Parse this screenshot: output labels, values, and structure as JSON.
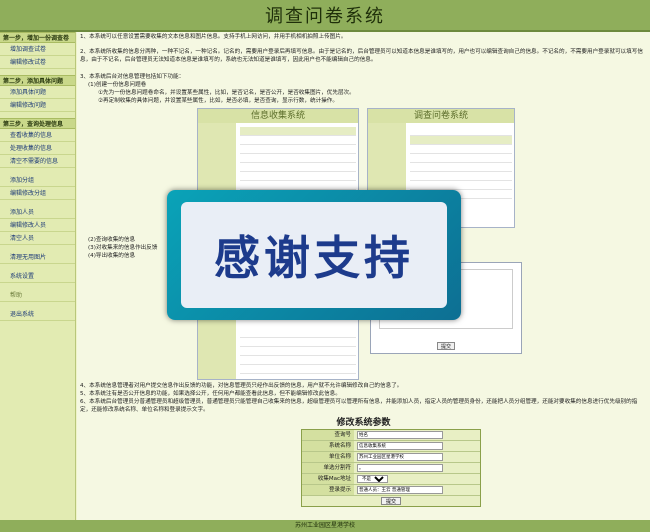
{
  "header": {
    "title": "调查问卷系统"
  },
  "sidebar": {
    "sections": [
      {
        "title": "第一步，增加一份调查卷",
        "items": [
          "增加调查试卷",
          "编辑修改试卷"
        ]
      },
      {
        "title": "第二步，添加具体问题",
        "items": [
          "添加具体问题",
          "编辑修改问题"
        ]
      },
      {
        "title": "第三步，查询处理信息",
        "items": [
          "查看收集的信息",
          "处理收集的信息",
          "清空不需要的信息"
        ]
      }
    ],
    "extra_items": [
      "添加分组",
      "编辑修改分组",
      "添加人员",
      "编辑修改人员",
      "清空人员",
      "清理无用图片",
      "系统设置",
      "帮助",
      "退出系统"
    ]
  },
  "main": {
    "p1": "1、本系统可以任意设置需要收集的文本信息和图片信息。支持手机上网访问，并用手机相机拍照上传图片。",
    "p2": "2、本系统所收集的信息分两种，一种不记名，一种记名。记名的，需要用户登录后再填写信息。由于是记名的，后台管理员可以知道本信息是谁填写的，用户也可以编辑查询自己的信息。不记名的，不需要用户登录就可以填写信息，由于不记名，后台管理员无法知道本信息是谁填写的，系统也无法知道是谁填写，因此用户也不能编辑自己的信息。",
    "p3": "3、本系统后台对信息管理包括如下功能：",
    "p3a": "(1)创建一份信息问题卷",
    "p3a1": "①先为一份信息问题卷命名，并设置某些属性，比如，是否记名，是否公开，是否收集图片，优先层次。",
    "p3a2": "②再定制收集的具体问题，并设置某些属性，比如，是否必填，是否查询，显示行数，统计操作。",
    "p3b": "(2)查询收集的信息",
    "p3c": "(3)对收集来的信息作出反馈",
    "p3d": "(4)导出收集的信息",
    "p4": "4、本系统信息管理者对用户提交信息作出反馈的功能，对信息管理员只经作出反馈的信息，用户就不允许编辑修改自己的信息了。",
    "p5": "5、本系统注有是否公开信息的功能，如果选择公开，任何用户都能查看此信息，但不能编辑修改此信息。",
    "p6": "6、本系统后台管理员分普通管理员和超级管理员，普通管理员只能管理自己收集来的信息，超级管理员可以管理所有信息，并能添加人员，指定人员的管理员身份，还能把人员分组管理，还能对要收集的信息进行优先级别的指定，还能修改系统名称、单位名称和登录提示文字。"
  },
  "screens": {
    "left_title": "信息收集系统",
    "right_title": "调查问卷系统",
    "dialog_button": "提交"
  },
  "thanks": {
    "text": "感谢支持"
  },
  "form": {
    "title": "修改系统参数",
    "rows": [
      {
        "label": "查询号",
        "value": "姓名"
      },
      {
        "label": "系统名称",
        "value": "信息收集系统"
      },
      {
        "label": "单位名称",
        "value": "苏州工业园区星港学校"
      },
      {
        "label": "单选分割符",
        "value": "。"
      },
      {
        "label": "收集Mac地址",
        "value": "不是"
      },
      {
        "label": "登录提示",
        "value": "普通人员：王云 普通管理"
      }
    ],
    "submit": "提交"
  },
  "footer": {
    "text": "苏州工业园区星港学校"
  }
}
